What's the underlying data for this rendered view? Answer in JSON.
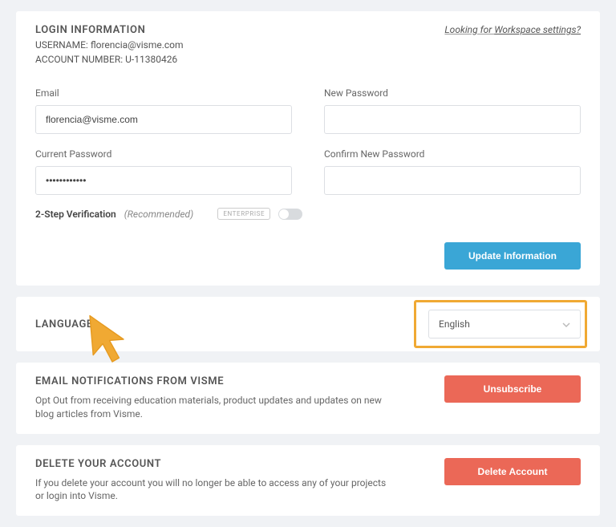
{
  "login": {
    "title": "LOGIN INFORMATION",
    "username_label": "USERNAME:",
    "username_value": "florencia@visme.com",
    "account_label": "ACCOUNT NUMBER:",
    "account_value": "U-11380426",
    "workspace_prefix": "Looking for ",
    "workspace_link": "Workspace settings?",
    "fields": {
      "email": {
        "label": "Email",
        "value": "florencia@visme.com"
      },
      "new_password": {
        "label": "New Password",
        "value": ""
      },
      "current_password": {
        "label": "Current Password",
        "value": "••••••••••••"
      },
      "confirm_password": {
        "label": "Confirm New Password",
        "value": ""
      }
    },
    "twofa": {
      "label": "2-Step Verification",
      "recommended": "(Recommended)",
      "badge": "ENTERPRISE",
      "enabled": false
    },
    "update_button": "Update Information"
  },
  "language": {
    "title": "LANGUAGE",
    "selected": "English"
  },
  "email_notifications": {
    "title": "EMAIL NOTIFICATIONS FROM VISME",
    "desc": "Opt Out from receiving education materials, product updates and updates on new blog articles from Visme.",
    "button": "Unsubscribe"
  },
  "delete_account": {
    "title": "DELETE YOUR ACCOUNT",
    "desc": "If you delete your account you will no longer be able to access any of your projects or login into Visme.",
    "button": "Delete Account"
  }
}
